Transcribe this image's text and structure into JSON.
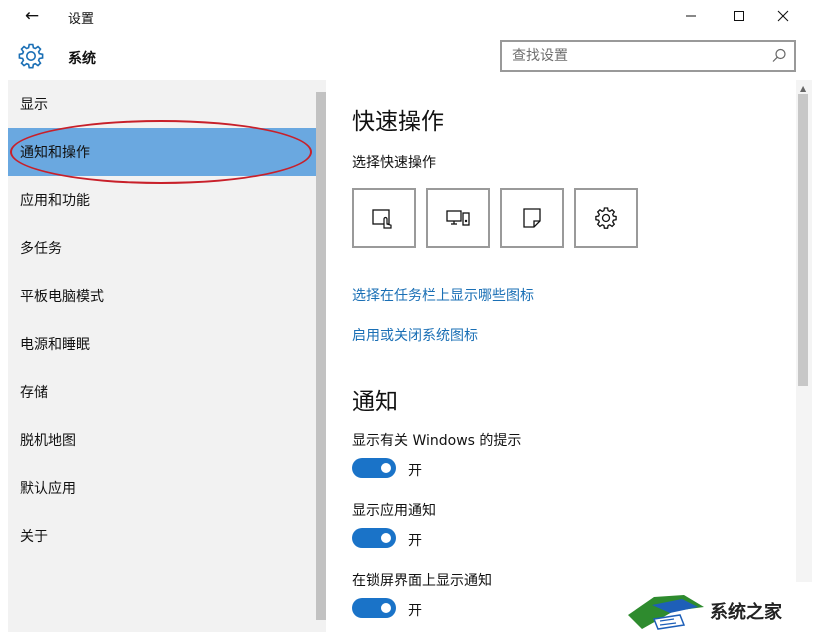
{
  "window": {
    "title": "设置"
  },
  "header": {
    "icon": "gear-icon",
    "title": "系统",
    "search_placeholder": "查找设置"
  },
  "sidebar": {
    "items": [
      {
        "label": "显示",
        "active": false
      },
      {
        "label": "通知和操作",
        "active": true
      },
      {
        "label": "应用和功能",
        "active": false
      },
      {
        "label": "多任务",
        "active": false
      },
      {
        "label": "平板电脑模式",
        "active": false
      },
      {
        "label": "电源和睡眠",
        "active": false
      },
      {
        "label": "存储",
        "active": false
      },
      {
        "label": "脱机地图",
        "active": false
      },
      {
        "label": "默认应用",
        "active": false
      },
      {
        "label": "关于",
        "active": false
      }
    ]
  },
  "main": {
    "quick_actions": {
      "heading": "快速操作",
      "subheading": "选择快速操作",
      "tiles": [
        "tablet-mode-icon",
        "project-icon",
        "note-icon",
        "settings-icon"
      ]
    },
    "links": [
      "选择在任务栏上显示哪些图标",
      "启用或关闭系统图标"
    ],
    "notifications": {
      "heading": "通知",
      "settings": [
        {
          "label": "显示有关 Windows 的提示",
          "state": "开",
          "on": true
        },
        {
          "label": "显示应用通知",
          "state": "开",
          "on": true
        },
        {
          "label": "在锁屏界面上显示通知",
          "state": "开",
          "on": true
        }
      ]
    }
  },
  "watermark": {
    "text": "系统之家"
  },
  "colors": {
    "accent": "#1a73c8",
    "selected": "#6aa8e0",
    "link": "#1a6fb5",
    "annotation": "#c8202a"
  }
}
